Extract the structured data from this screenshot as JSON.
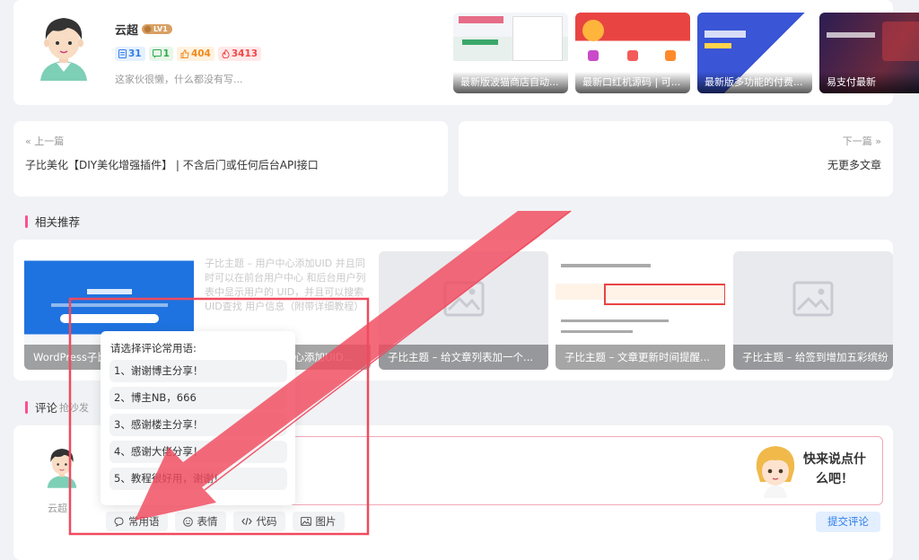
{
  "author": {
    "name": "云超",
    "level": "LV1",
    "stats": {
      "posts": "31",
      "comments": "1",
      "likes": "404",
      "hot": "3413"
    },
    "bio": "这家伙很懒，什么都没有写..."
  },
  "author_posts": [
    "最新版波猫商店自动...",
    "最新口红机源码 | 可...",
    "最新版多功能的付费...",
    "易支付最新"
  ],
  "navigation": {
    "prev_label": "上一篇",
    "prev_title": "子比美化【DIY美化增强插件】 | 不含后门或任何后台API接口",
    "next_label": "下一篇",
    "next_title": "无更多文章"
  },
  "related": {
    "heading": "相关推荐",
    "items": [
      {
        "caption": "WordPress子比主题..."
      },
      {
        "caption": "子比主题 – 用户中心添加UID...",
        "broken_alt": "子比主题 – 用户中心添加UID 并且同时可以在前台用户中心 和后台用户列表中显示用户的 UID，并且可以搜索UID查找 用户信息（附带详细教程）",
        "visible_caption": "心添加UID..."
      },
      {
        "caption": "子比主题 – 给文章列表加一个..."
      },
      {
        "caption": "子比主题 – 文章更新时间提醒..."
      },
      {
        "caption": "子比主题 – 给签到增加五彩缤纷"
      }
    ]
  },
  "comments": {
    "heading": "评论",
    "sub": "抢沙发",
    "user": "云超",
    "sticker_text": "快来说点什么吧！",
    "tools": {
      "phrases": "常用语",
      "emoji": "表情",
      "code": "代码",
      "image": "图片"
    },
    "submit": "提交评论"
  },
  "phrases_popup": {
    "title": "请选择评论常用语:",
    "items": [
      "1、谢谢博主分享！",
      "2、博主NB，666",
      "3、感谢楼主分享！",
      "4、感谢大佬分享！",
      "5、教程很好用，谢谢！"
    ]
  },
  "colors": {
    "accent_pink": "#ff4f8a",
    "annotation_red": "#f04a5e",
    "primary_blue": "#2f7ee8"
  }
}
